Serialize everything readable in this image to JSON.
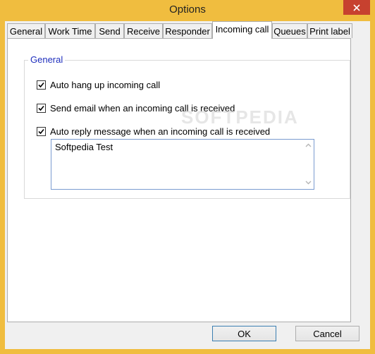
{
  "window": {
    "title": "Options"
  },
  "tabs": [
    {
      "label": "General"
    },
    {
      "label": "Work Time"
    },
    {
      "label": "Send"
    },
    {
      "label": "Receive"
    },
    {
      "label": "Responder"
    },
    {
      "label": "Incoming call"
    },
    {
      "label": "Queues"
    },
    {
      "label": "Print label"
    }
  ],
  "active_tab": "Incoming call",
  "group": {
    "title": "General",
    "options": [
      {
        "label": "Auto hang up incoming call",
        "checked": true
      },
      {
        "label": "Send email when an incoming call is received",
        "checked": true
      },
      {
        "label": "Auto reply message when an incoming call is received",
        "checked": true
      }
    ],
    "reply_message": "Softpedia Test"
  },
  "watermark": "SOFTPEDIA",
  "buttons": {
    "ok": "OK",
    "cancel": "Cancel"
  },
  "colors": {
    "titlebar": "#f0bd3f",
    "close": "#c7412f",
    "group_label": "#1f2fbd"
  }
}
